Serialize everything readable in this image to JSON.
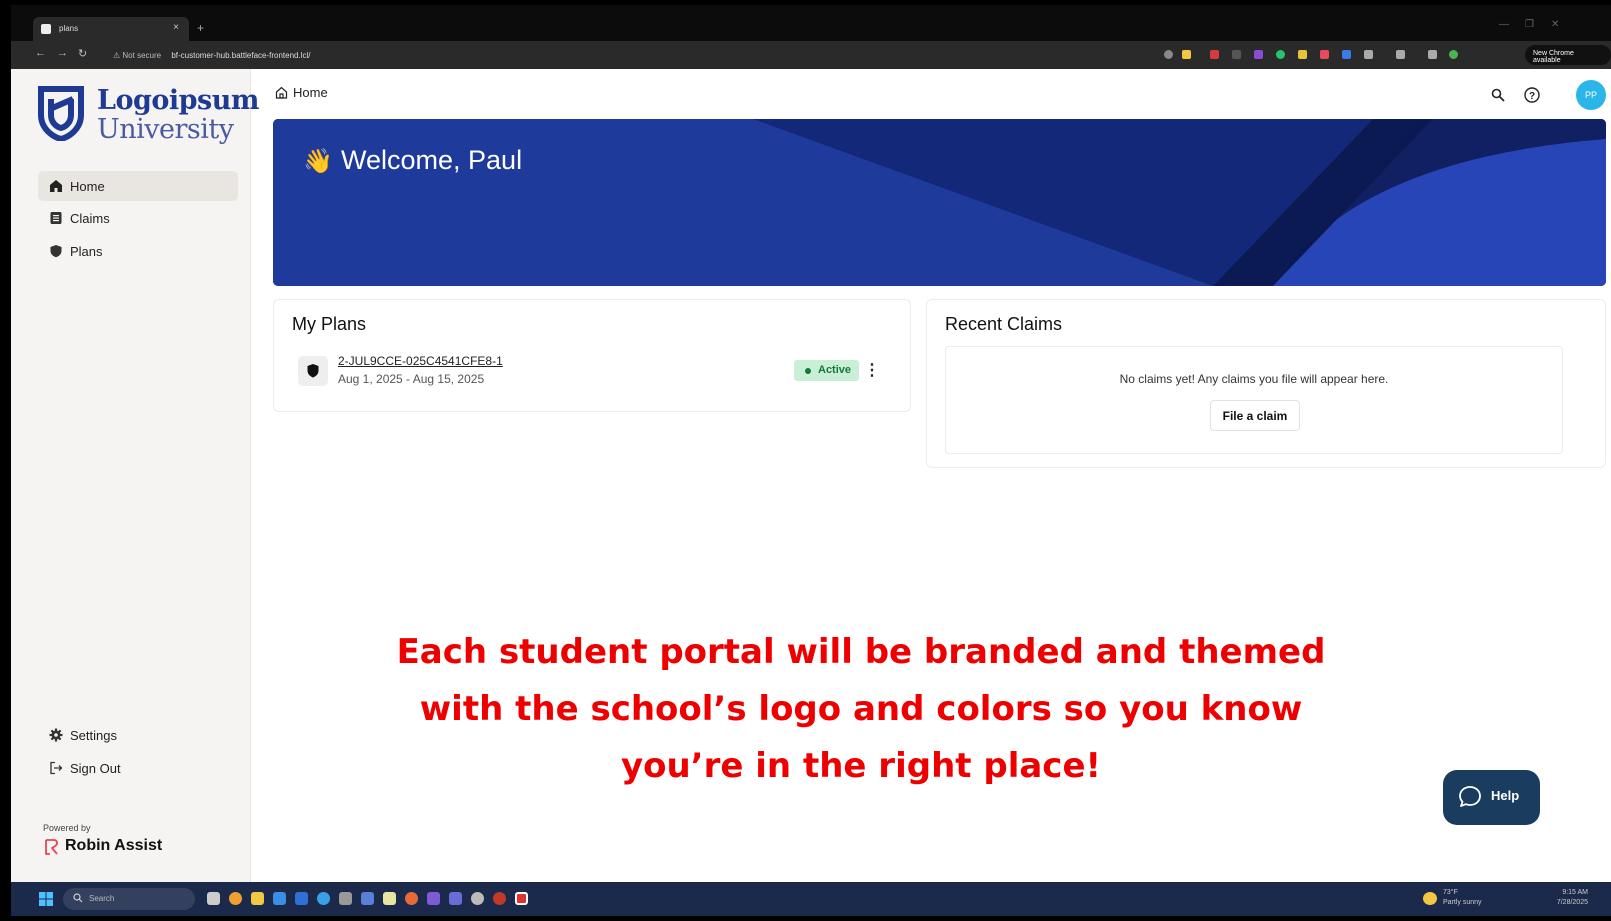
{
  "browser": {
    "tab_title": "plans",
    "tab_close": "×",
    "new_tab": "+",
    "not_secure": "⚠ Not secure",
    "url": "bf-customer-hub.battleface-frontend.lcl/",
    "new_chrome": "New Chrome available"
  },
  "logo": {
    "line1": "Logoipsum",
    "line2": "University"
  },
  "sidebar": {
    "items": [
      {
        "label": "Home",
        "icon": "home-icon"
      },
      {
        "label": "Claims",
        "icon": "document-icon"
      },
      {
        "label": "Plans",
        "icon": "shield-icon"
      }
    ],
    "bottom": [
      {
        "label": "Settings",
        "icon": "gear-icon"
      },
      {
        "label": "Sign Out",
        "icon": "sign-out-icon"
      }
    ],
    "powered_by": "Powered by",
    "brand": "Robin Assist"
  },
  "header": {
    "breadcrumb": "Home",
    "avatar_initials": "PP"
  },
  "banner": {
    "welcome": "Welcome, Paul",
    "emoji": "👋"
  },
  "plans": {
    "title": "My Plans",
    "items": [
      {
        "id": "2-JUL9CCE-025C4541CFE8-1",
        "dates": "Aug 1, 2025 - Aug 15, 2025",
        "status": "Active"
      }
    ]
  },
  "claims": {
    "title": "Recent Claims",
    "empty_text": "No claims yet! Any claims you file will appear here.",
    "file_button": "File a claim"
  },
  "overlay": {
    "line1": "Each student portal will be branded and themed",
    "line2": "with the school’s logo and colors so you know",
    "line3": "you’re in the right place!"
  },
  "help_button": "Help",
  "taskbar": {
    "search": "Search",
    "weather_temp": "73°F",
    "weather_text": "Partly sunny",
    "time": "9:15 AM",
    "date": "7/28/2025"
  },
  "colors": {
    "brand_blue": "#1f3a93",
    "banner_blue": "#1e3a9a",
    "active_badge_bg": "#c9f0d6",
    "active_badge_text": "#16763d",
    "overlay_red": "#ee0000",
    "help_button_bg": "#1a3c5e",
    "avatar_bg": "#2bb5e8"
  }
}
